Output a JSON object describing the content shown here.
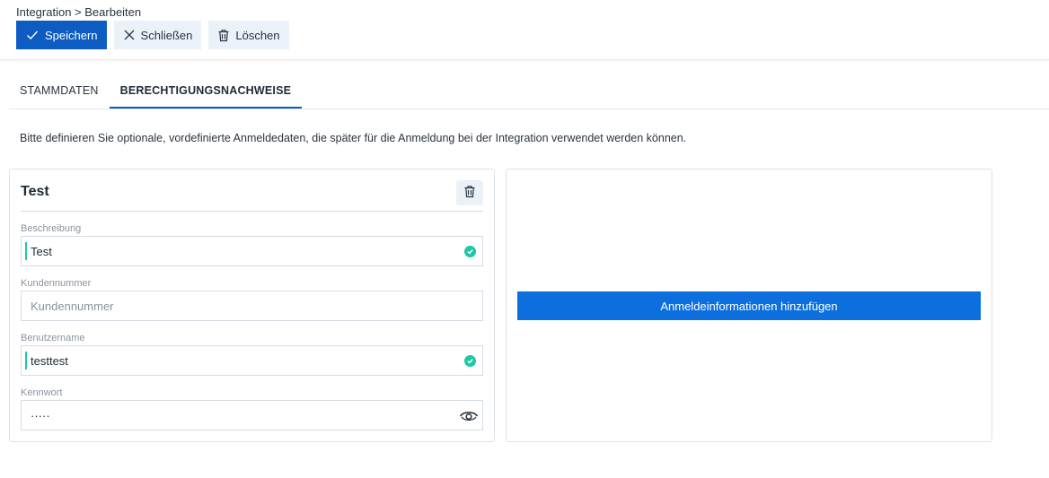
{
  "header": {
    "breadcrumb": "Integration > Bearbeiten",
    "save_label": "Speichern",
    "close_label": "Schließen",
    "delete_label": "Löschen"
  },
  "tabs": [
    {
      "label": "STAMMDATEN",
      "active": false
    },
    {
      "label": "BERECHTIGUNGSNACHWEISE",
      "active": true
    }
  ],
  "info_text": "Bitte definieren Sie optionale, vordefinierte Anmeldedaten, die später für die Anmeldung bei der Integration verwendet werden können.",
  "credential": {
    "title": "Test",
    "fields": {
      "description": {
        "label": "Beschreibung",
        "value": "Test",
        "valid": true
      },
      "customer_number": {
        "label": "Kundennummer",
        "value": "",
        "placeholder": "Kundennummer"
      },
      "username": {
        "label": "Benutzername",
        "value": "testtest",
        "valid": true
      },
      "password": {
        "label": "Kennwort",
        "value": "·····"
      }
    }
  },
  "add_button_label": "Anmeldeinformationen hinzufügen",
  "icons": {
    "save": "check-icon",
    "close": "close-icon",
    "delete": "trash-icon",
    "valid": "check-circle-icon",
    "show_password": "eye-icon"
  },
  "colors": {
    "primary": "#0d5cc2",
    "add_button": "#0d6fdd",
    "secondary_button": "#eaf1f8",
    "valid": "#1ec8a5"
  }
}
